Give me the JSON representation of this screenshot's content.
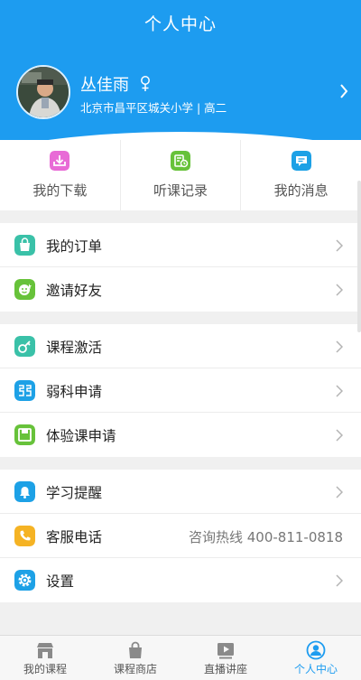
{
  "header": {
    "title": "个人中心",
    "user": {
      "name": "丛佳雨",
      "school": "北京市昌平区城关小学 | 高二"
    }
  },
  "quick_actions": [
    {
      "label": "我的下载",
      "icon": "download-icon",
      "color": "#e86bd6"
    },
    {
      "label": "听课记录",
      "icon": "history-icon",
      "color": "#67c23a"
    },
    {
      "label": "我的消息",
      "icon": "message-icon",
      "color": "#1da1e6"
    }
  ],
  "groups": [
    {
      "items": [
        {
          "label": "我的订单",
          "icon": "bag-icon",
          "color": "#3ac1a8"
        },
        {
          "label": "邀请好友",
          "icon": "friend-icon",
          "color": "#67c23a"
        }
      ]
    },
    {
      "items": [
        {
          "label": "课程激活",
          "icon": "key-icon",
          "color": "#3ac1a8"
        },
        {
          "label": "弱科申请",
          "icon": "subject-icon",
          "color": "#1da1e6"
        },
        {
          "label": "体验课申请",
          "icon": "trial-icon",
          "color": "#67c23a"
        }
      ]
    },
    {
      "items": [
        {
          "label": "学习提醒",
          "icon": "bell-icon",
          "color": "#1da1e6"
        },
        {
          "label": "客服电话",
          "icon": "phone-icon",
          "color": "#f5b324",
          "value": "咨询热线 400-811-0818"
        },
        {
          "label": "设置",
          "icon": "gear-icon",
          "color": "#1da1e6"
        }
      ]
    }
  ],
  "tabbar": [
    {
      "label": "我的课程",
      "icon": "store-icon",
      "active": false
    },
    {
      "label": "课程商店",
      "icon": "shopping-bag-icon",
      "active": false
    },
    {
      "label": "直播讲座",
      "icon": "video-icon",
      "active": false
    },
    {
      "label": "个人中心",
      "icon": "user-icon",
      "active": true
    }
  ],
  "colors": {
    "primary": "#1d9cf0",
    "background": "#f0f0f0",
    "text": "#222222",
    "muted": "#777777"
  }
}
